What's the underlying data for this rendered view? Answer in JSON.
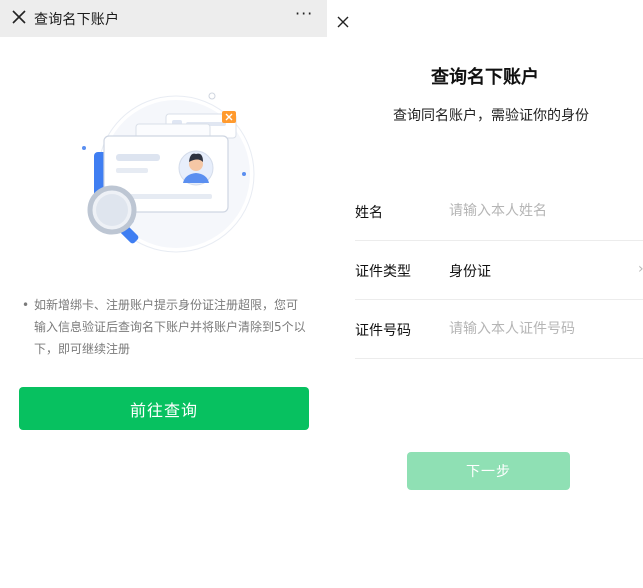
{
  "left": {
    "nav": {
      "title": "查询名下账户",
      "close_icon": "close-icon",
      "more_icon": "more-icon",
      "more_glyph": "···"
    },
    "illustration": "id-card-magnifier-illustration",
    "notice": {
      "bullet": "•",
      "text": "如新增绑卡、注册账户提示身份证注册超限，您可输入信息验证后查询名下账户并将账户清除到5个以下，即可继续注册"
    },
    "button_label": "前往查询",
    "colors": {
      "primary": "#07c160",
      "nav_bg": "#ededed"
    }
  },
  "right": {
    "close_icon": "close-icon",
    "title": "查询名下账户",
    "subtitle": "查询同名账户，需验证你的身份",
    "form": {
      "name": {
        "label": "姓名",
        "placeholder": "请输入本人姓名"
      },
      "id_type": {
        "label": "证件类型",
        "value": "身份证",
        "chevron": "›"
      },
      "id_number": {
        "label": "证件号码",
        "placeholder": "请输入本人证件号码"
      }
    },
    "next_label": "下一步",
    "colors": {
      "disabled_button": "#8fe0b4"
    }
  }
}
